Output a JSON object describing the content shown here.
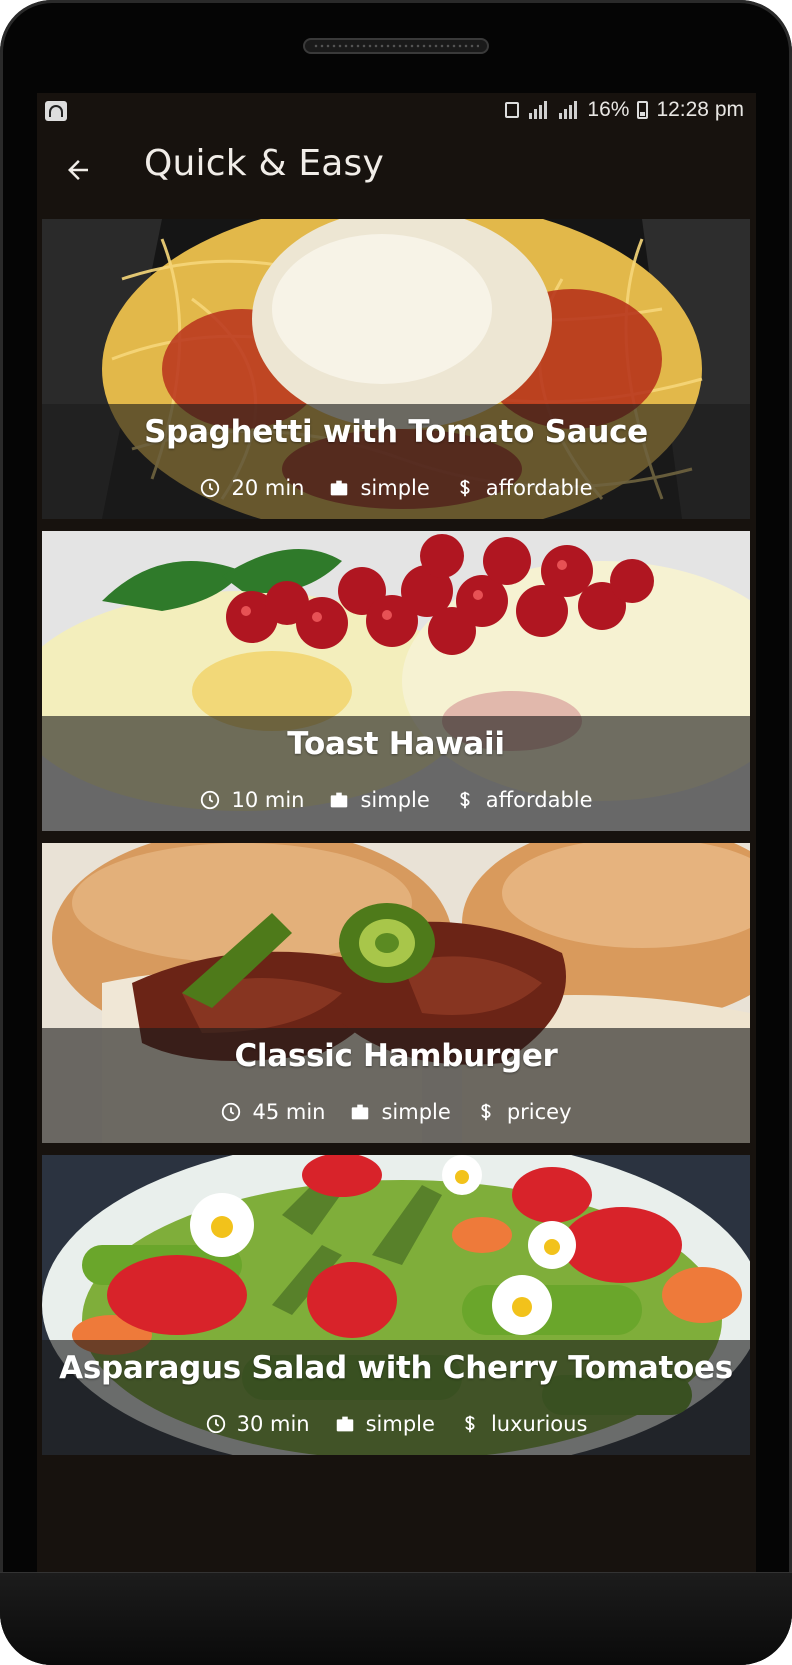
{
  "status_bar": {
    "battery": "16%",
    "time": "12:28 pm"
  },
  "app_bar": {
    "title": "Quick & Easy",
    "back_icon": "arrow-back-icon"
  },
  "meals": [
    {
      "title": "Spaghetti with Tomato Sauce",
      "duration": "20 min",
      "complexity": "simple",
      "affordability": "affordable"
    },
    {
      "title": "Toast Hawaii",
      "duration": "10 min",
      "complexity": "simple",
      "affordability": "affordable"
    },
    {
      "title": "Classic Hamburger",
      "duration": "45 min",
      "complexity": "simple",
      "affordability": "pricey"
    },
    {
      "title": "Asparagus Salad with Cherry Tomatoes",
      "duration": "30 min",
      "complexity": "simple",
      "affordability": "luxurious"
    }
  ],
  "meta_icons": {
    "duration": "clock-icon",
    "complexity": "briefcase-icon",
    "affordability": "dollar-icon"
  },
  "colors": {
    "background": "#17120e",
    "card_overlay": "#1c1c1c",
    "text": "#ffffff"
  }
}
